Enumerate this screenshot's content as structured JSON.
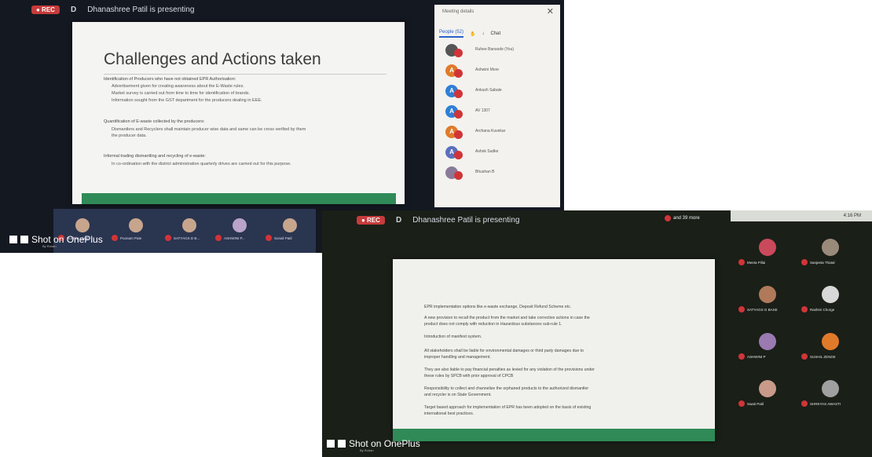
{
  "photo1": {
    "rec_label": "● REC",
    "presenter_initial": "D",
    "presenting_text": "Dhanashree Patil is presenting",
    "slide": {
      "title": "Challenges and Actions taken",
      "lines": [
        "Identification of Producers who have not obtained EPR Authorisation:",
        "Advertisement given for creating awareness about the E-Waste rules.",
        "Market survey is carried out from time to time for identification of brands.",
        "Information sought from the GST department for the producers dealing in EEE.",
        "Quantification of E-waste collected by the producers:",
        "Dismantlers and Recyclers shall maintain producer wise data and same can be cross verified by them",
        "the producer data.",
        "Informal trading dismantling and recycling of e-waste:",
        "In co-ordination with the district administration quarterly drives are carried out for this purpose."
      ]
    },
    "panel": {
      "header": "Meeting details",
      "close": "✕",
      "people_tab": "People (52)",
      "chat_tab": "Chat",
      "participants": [
        {
          "initial": "",
          "name": "Ruhee Bansode (You)",
          "color": "#555555"
        },
        {
          "initial": "A",
          "name": "Ashwini More",
          "color": "#e07a2a"
        },
        {
          "initial": "A",
          "name": "Ankush Sabale",
          "color": "#2f7fd6"
        },
        {
          "initial": "A",
          "name": "AV 1307",
          "color": "#2f7fd6"
        },
        {
          "initial": "A",
          "name": "Archana Kuvekar",
          "color": "#e07a2a"
        },
        {
          "initial": "A",
          "name": "Ashok Sudke",
          "color": "#5a6fbf"
        },
        {
          "initial": "",
          "name": "Bhushan B",
          "color": "#8a7a9a"
        }
      ]
    },
    "strip": [
      {
        "name": "Ruchita Ujwal"
      },
      {
        "name": "Poonam Pate"
      },
      {
        "name": "SATYAGS D B..."
      },
      {
        "name": "ASHWINI P..."
      },
      {
        "name": "Sonali Patil"
      }
    ],
    "watermark": "Shot on OnePlus",
    "watermark_sub": "By Rohan"
  },
  "photo2": {
    "rec_label": "● REC",
    "presenter_initial": "D",
    "presenting_text": "Dhanashree Patil is presenting",
    "others_text": "and 39 more",
    "time_text": "4:16 PM",
    "slide_lines": [
      "EPR implementation options like e-waste exchange, Deposit Refund Scheme etc.",
      "A new provision to recall the product from the market and take corrective actions in case the",
      "product does not comply with reduction in Hazardous substances sub-rule 1.",
      "Introduction of manifest system.",
      "All stakeholders shall be liable for environmental damages or third party damages due to",
      "improper handling and management.",
      "They are also liable to pay financial penalties as levied for any violation of the provisions under",
      "these rules by SPCB with prior approval of CPCB",
      "Responsibility to collect and channelize the orphaned products to the authorized dismantler",
      "and recycler is on State Government.",
      "Target based approach for implementation of EPR has been adopted on the basis of existing",
      "international best practices."
    ],
    "grid": [
      {
        "name": "Meeta Pillai",
        "color": "#c94a5a"
      },
      {
        "name": "Sanjeeta Thatal",
        "color": "#9a8a7a"
      },
      {
        "name": "SATYAGS G BASE",
        "color": "#b07a5a"
      },
      {
        "name": "Rashmi Chorge",
        "color": "#d8d8d8"
      },
      {
        "name": "ASHWINI P",
        "color": "#9a7ab0"
      },
      {
        "name": "SUSHIL ZENDE",
        "color": "#e07a2a"
      },
      {
        "name": "Swati Patil",
        "color": "#c79a8a"
      },
      {
        "name": "SHREYAS AWASTI",
        "color": "#a0a0a0"
      }
    ],
    "watermark": "Shot on OnePlus",
    "watermark_sub": "By Rohan"
  }
}
